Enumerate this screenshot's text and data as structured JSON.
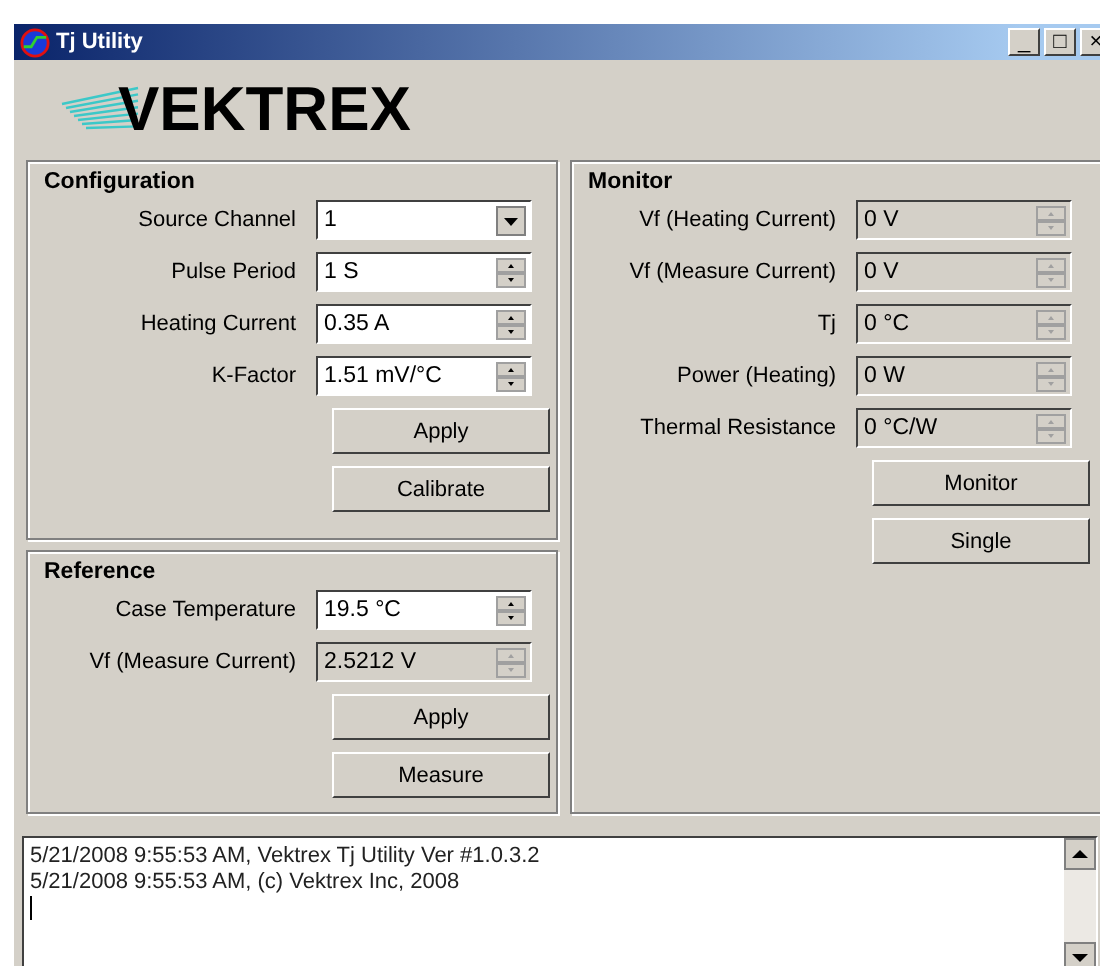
{
  "window": {
    "title": "Tj Utility",
    "controls": [
      "_",
      "□",
      "×"
    ]
  },
  "logo": {
    "text": "VEKTREX"
  },
  "configuration": {
    "title": "Configuration",
    "fields": [
      {
        "label": "Source Channel",
        "value": "1",
        "kind": "dropdown",
        "disabled": false
      },
      {
        "label": "Pulse Period",
        "value": "1 S",
        "kind": "spin",
        "disabled": false
      },
      {
        "label": "Heating Current",
        "value": "0.35 A",
        "kind": "spin",
        "disabled": false
      },
      {
        "label": "K-Factor",
        "value": "1.51 mV/°C",
        "kind": "spin",
        "disabled": false
      }
    ],
    "buttons": [
      "Apply",
      "Calibrate"
    ]
  },
  "reference": {
    "title": "Reference",
    "fields": [
      {
        "label": "Case Temperature",
        "value": "19.5 °C",
        "kind": "spin",
        "disabled": false
      },
      {
        "label": "Vf (Measure Current)",
        "value": "2.5212 V",
        "kind": "spin",
        "disabled": true
      }
    ],
    "buttons": [
      "Apply",
      "Measure"
    ]
  },
  "monitor": {
    "title": "Monitor",
    "fields": [
      {
        "label": "Vf (Heating Current)",
        "value": "0 V",
        "kind": "spin",
        "disabled": true
      },
      {
        "label": "Vf (Measure Current)",
        "value": "0 V",
        "kind": "spin",
        "disabled": true
      },
      {
        "label": "Tj",
        "value": "0 °C",
        "kind": "spin",
        "disabled": true
      },
      {
        "label": "Power (Heating)",
        "value": "0 W",
        "kind": "spin",
        "disabled": true
      },
      {
        "label": "Thermal Resistance",
        "value": "0 °C/W",
        "kind": "spin",
        "disabled": true
      }
    ],
    "buttons": [
      "Monitor",
      "Single"
    ]
  },
  "log": {
    "lines": [
      "5/21/2008 9:55:53 AM, Vektrex Tj Utility Ver #1.0.3.2",
      "5/21/2008 9:55:53 AM, (c) Vektrex Inc, 2008"
    ]
  }
}
